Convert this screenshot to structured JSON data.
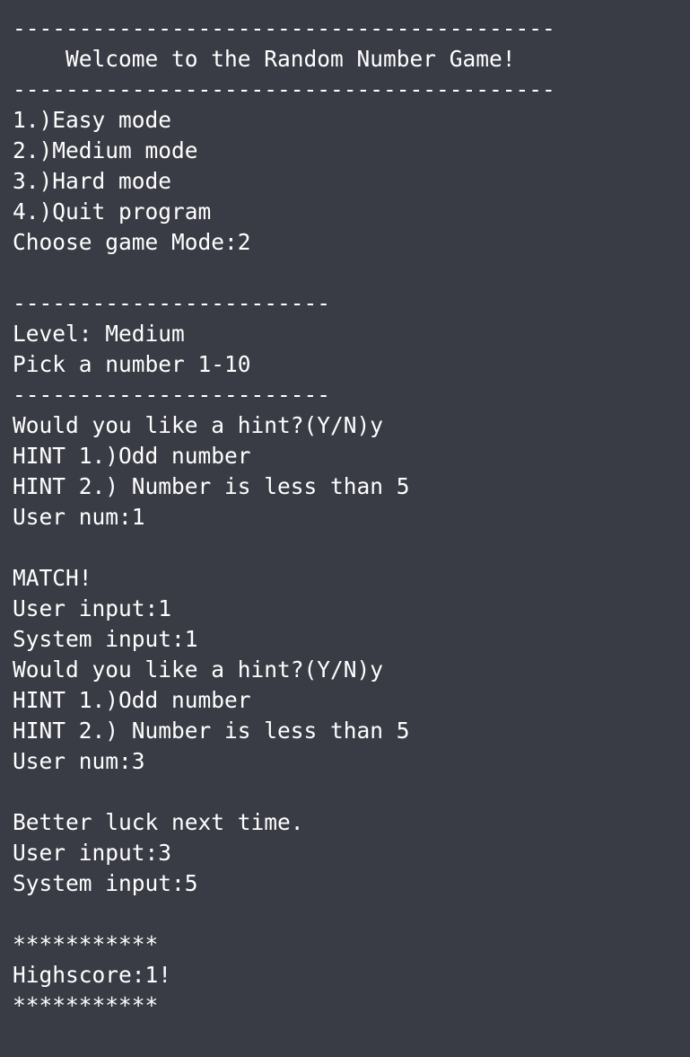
{
  "terminal": {
    "lines": [
      "-----------------------------------------",
      "    Welcome to the Random Number Game!",
      "-----------------------------------------",
      "1.)Easy mode",
      "2.)Medium mode",
      "3.)Hard mode",
      "4.)Quit program",
      "Choose game Mode:2",
      "",
      "------------------------",
      "Level: Medium",
      "Pick a number 1-10",
      "------------------------",
      "Would you like a hint?(Y/N)y",
      "HINT 1.)Odd number",
      "HINT 2.) Number is less than 5",
      "User num:1",
      "",
      "MATCH!",
      "User input:1",
      "System input:1",
      "Would you like a hint?(Y/N)y",
      "HINT 1.)Odd number",
      "HINT 2.) Number is less than 5",
      "User num:3",
      "",
      "Better luck next time.",
      "User input:3",
      "System input:5",
      "",
      "***********",
      "Highscore:1!",
      "***********"
    ]
  }
}
